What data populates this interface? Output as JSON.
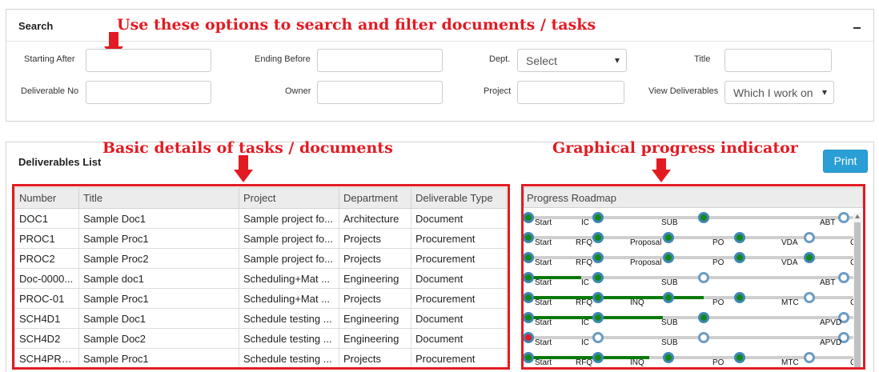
{
  "annotations": {
    "search_note": "Use these options to search and filter documents / tasks",
    "list_note": "Basic details of tasks / documents",
    "progress_note": "Graphical progress indicator"
  },
  "search": {
    "title": "Search",
    "starting_after_label": "Starting After",
    "ending_before_label": "Ending Before",
    "dept_label": "Dept.",
    "dept_value": "Select",
    "title_label": "Title",
    "deliverable_no_label": "Deliverable No",
    "owner_label": "Owner",
    "project_label": "Project",
    "view_label": "View Deliverables",
    "view_value": "Which I work on"
  },
  "list": {
    "title": "Deliverables List",
    "print_label": "Print",
    "columns": [
      "Number",
      "Title",
      "Project",
      "Department",
      "Deliverable Type"
    ],
    "roadmap_header": "Progress Roadmap",
    "rows": [
      {
        "number": "DOC1",
        "title": "Sample Doc1",
        "project": "Sample project fo...",
        "department": "Architecture",
        "type": "Document"
      },
      {
        "number": "PROC1",
        "title": "Sample Proc1",
        "project": "Sample project fo...",
        "department": "Projects",
        "type": "Procurement"
      },
      {
        "number": "PROC2",
        "title": "Sample Proc2",
        "project": "Sample project fo...",
        "department": "Projects",
        "type": "Procurement"
      },
      {
        "number": "Doc-0000...",
        "title": "Sample doc1",
        "project": "Scheduling+Mat ...",
        "department": "Engineering",
        "type": "Document"
      },
      {
        "number": "PROC-01",
        "title": "Sample Proc1",
        "project": "Scheduling+Mat ...",
        "department": "Projects",
        "type": "Procurement"
      },
      {
        "number": "SCH4D1",
        "title": "Sample Doc1",
        "project": "Schedule testing ...",
        "department": "Engineering",
        "type": "Document"
      },
      {
        "number": "SCH4D2",
        "title": "Sample Doc2",
        "project": "Schedule testing ...",
        "department": "Engineering",
        "type": "Document"
      },
      {
        "number": "SCH4PRO...",
        "title": "Sample Proc1",
        "project": "Schedule testing ...",
        "department": "Projects",
        "type": "Procurement"
      }
    ],
    "roadmap": [
      {
        "stages": [
          "Start",
          "IC",
          "SUB",
          "ABT"
        ],
        "status": [
          "done",
          "done",
          "done",
          "pending"
        ],
        "progress": 0
      },
      {
        "stages": [
          "Start",
          "RFQ",
          "Proposal",
          "PO",
          "VDA",
          "C"
        ],
        "status": [
          "done",
          "done",
          "done",
          "done",
          "pending",
          "pending"
        ],
        "progress": 0
      },
      {
        "stages": [
          "Start",
          "RFQ",
          "Proposal",
          "PO",
          "VDA",
          "C"
        ],
        "status": [
          "done",
          "done",
          "done",
          "done",
          "done",
          "pending"
        ],
        "progress": 0
      },
      {
        "stages": [
          "Start",
          "IC",
          "SUB",
          "ABT"
        ],
        "status": [
          "done",
          "done",
          "pending",
          "pending"
        ],
        "progress": 0.2
      },
      {
        "stages": [
          "Start",
          "RFQ",
          "INQ",
          "PO",
          "MTC",
          "C"
        ],
        "status": [
          "done",
          "done",
          "done",
          "done",
          "pending",
          "pending"
        ],
        "progress": 0.65
      },
      {
        "stages": [
          "Start",
          "IC",
          "SUB",
          "APVD"
        ],
        "status": [
          "done",
          "done",
          "done",
          "pending"
        ],
        "progress": 0.5
      },
      {
        "stages": [
          "Start",
          "IC",
          "SUB",
          "APVD"
        ],
        "status": [
          "alert",
          "pending",
          "pending",
          "pending"
        ],
        "progress": 0
      },
      {
        "stages": [
          "Start",
          "RFQ",
          "INQ",
          "PO",
          "MTC",
          "C"
        ],
        "status": [
          "done",
          "done",
          "done",
          "done",
          "pending",
          "pending"
        ],
        "progress": 0.45
      }
    ]
  },
  "colors": {
    "accent": "#2a9fd6",
    "annotation": "#e21b23",
    "done": "#16881a",
    "ring": "#3f87b6"
  }
}
